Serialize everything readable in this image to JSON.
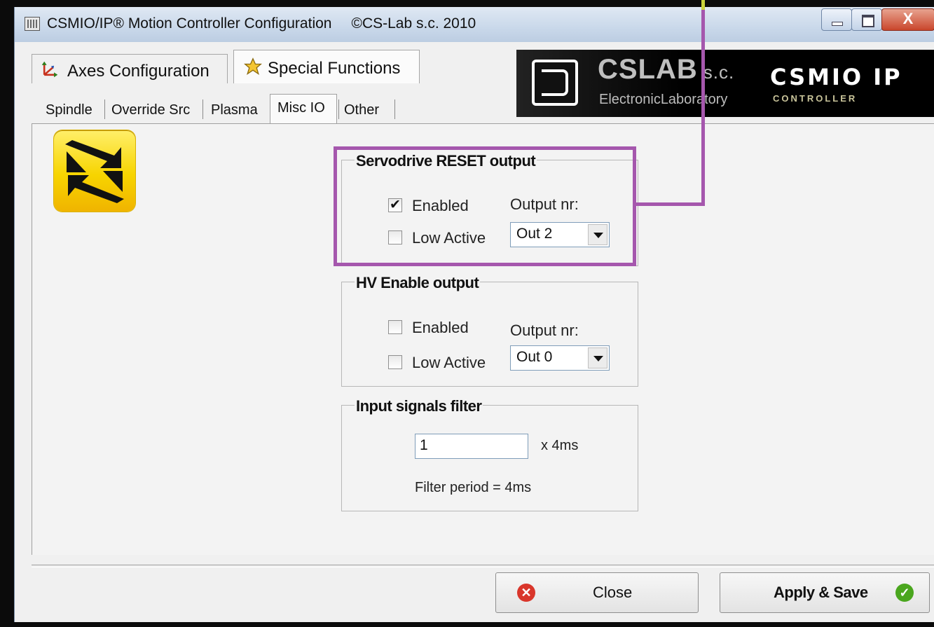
{
  "window": {
    "title": "CSMIO/IP® Motion Controller Configuration",
    "copyright": "©CS-Lab s.c. 2010",
    "close_glyph": "X"
  },
  "main_tabs": [
    {
      "label": "Axes Configuration",
      "icon": "axes-icon",
      "active": false
    },
    {
      "label": "Special Functions",
      "icon": "star-icon",
      "active": true
    }
  ],
  "logo": {
    "company": "CSLAB",
    "suffix": "s.c.",
    "subtitle": "ElectronicLaboratory",
    "product": "CSMIO IP",
    "product_sub": "CONTROLLER"
  },
  "sub_tabs": [
    {
      "label": "Spindle",
      "active": false
    },
    {
      "label": "Override Src",
      "active": false
    },
    {
      "label": "Plasma",
      "active": false
    },
    {
      "label": "Misc IO",
      "active": true
    },
    {
      "label": "Other",
      "active": false
    }
  ],
  "servo_reset": {
    "title": "Servodrive RESET output",
    "enabled_label": "Enabled",
    "enabled_checked": true,
    "low_active_label": "Low Active",
    "low_active_checked": false,
    "output_label": "Output nr:",
    "output_value": "Out 2"
  },
  "hv_enable": {
    "title": "HV Enable output",
    "enabled_label": "Enabled",
    "enabled_checked": false,
    "low_active_label": "Low Active",
    "low_active_checked": false,
    "output_label": "Output nr:",
    "output_value": "Out 0"
  },
  "input_filter": {
    "title": "Input signals filter",
    "value": "1",
    "unit": "x 4ms",
    "period_text": "Filter period = 4ms"
  },
  "buttons": {
    "close": "Close",
    "apply": "Apply & Save"
  },
  "colors": {
    "highlight": "#a557ad",
    "close_icon": "#d9362b",
    "apply_icon": "#4aa61e"
  }
}
